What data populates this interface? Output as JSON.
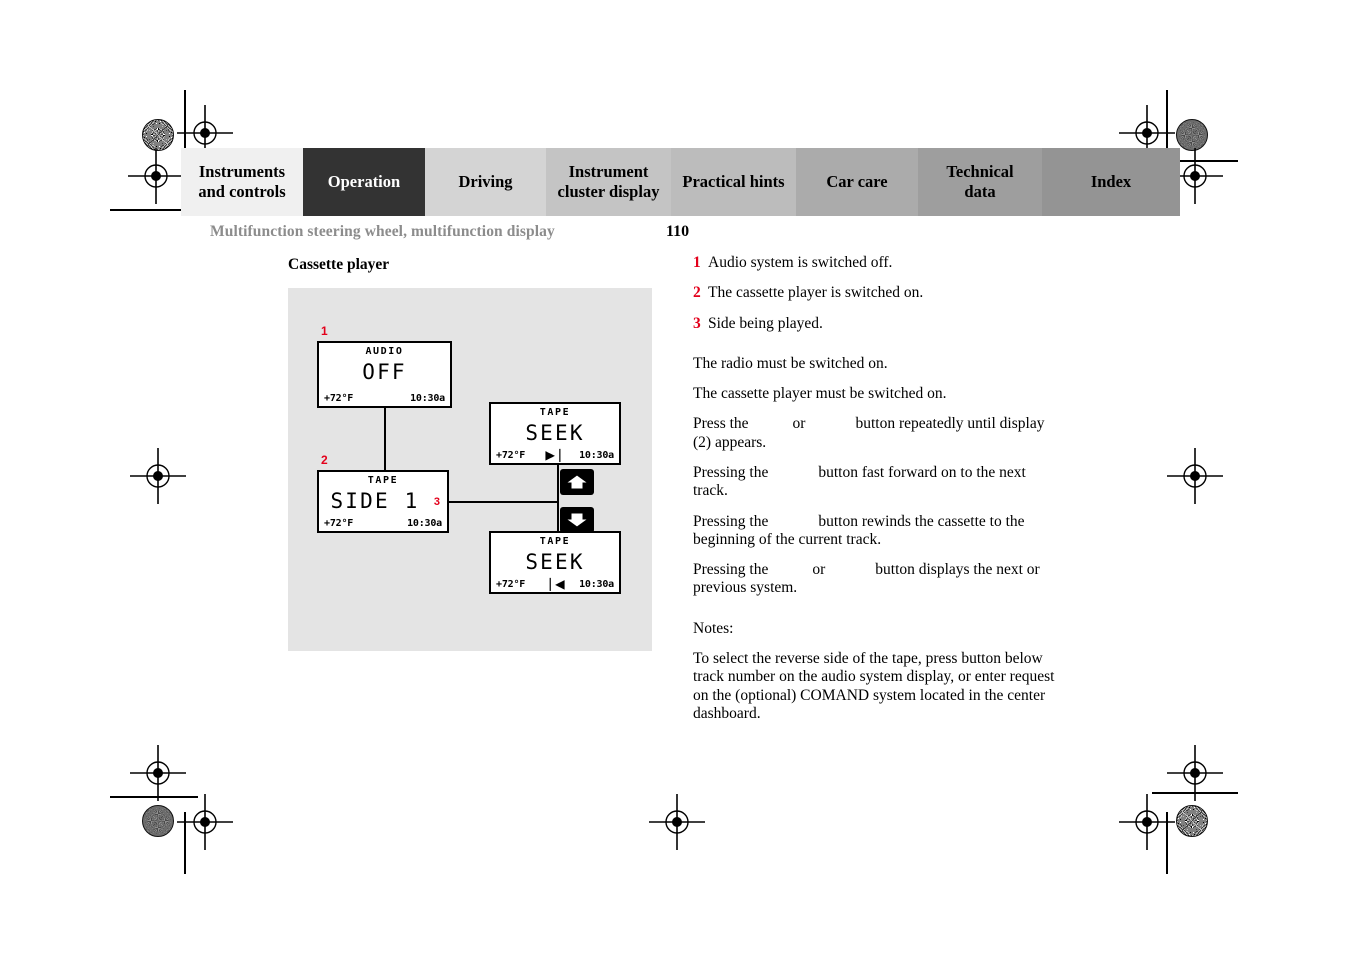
{
  "tabs": [
    {
      "label": "Instruments\nand controls",
      "bg": "#f0f0f0",
      "active": false
    },
    {
      "label": "Operation",
      "bg": "#333333",
      "active": true
    },
    {
      "label": "Driving",
      "bg": "#d4d4d4",
      "active": false
    },
    {
      "label": "Instrument\ncluster display",
      "bg": "#c4c4c4",
      "active": false
    },
    {
      "label": "Practical hints",
      "bg": "#bcbcbc",
      "active": false
    },
    {
      "label": "Car care",
      "bg": "#ababab",
      "active": false
    },
    {
      "label": "Technical\ndata",
      "bg": "#9e9e9e",
      "active": false
    },
    {
      "label": "Index",
      "bg": "#949494",
      "active": false
    }
  ],
  "header": {
    "running_title": "Multifunction steering wheel, multifunction display",
    "page_number": "110"
  },
  "section": {
    "title": "Cassette player"
  },
  "figure": {
    "callouts": {
      "one": "1",
      "two": "2",
      "three": "3"
    },
    "displays": [
      {
        "name": "audio-off",
        "top": "AUDIO",
        "main": "OFF",
        "bottom_left": "+72°F",
        "bottom_right": "10:30a",
        "bottom_center": ""
      },
      {
        "name": "tape-side-1",
        "top": "TAPE",
        "main": "SIDE 1",
        "bottom_left": "+72°F",
        "bottom_right": "10:30a",
        "bottom_center": ""
      },
      {
        "name": "tape-seek-forward",
        "top": "TAPE",
        "main": "SEEK",
        "bottom_left": "+72°F",
        "bottom_right": "10:30a",
        "bottom_center": "▶❘"
      },
      {
        "name": "tape-seek-rewind",
        "top": "TAPE",
        "main": "SEEK",
        "bottom_left": "+72°F",
        "bottom_right": "10:30a",
        "bottom_center": "❘◀"
      }
    ],
    "buttons": [
      {
        "name": "scroll-up-button",
        "icon": "arrow-up-icon"
      },
      {
        "name": "scroll-down-button",
        "icon": "arrow-down-icon"
      }
    ]
  },
  "legend": [
    {
      "num": "1",
      "text": "Audio system is switched off."
    },
    {
      "num": "2",
      "text": "The cassette player is switched on."
    },
    {
      "num": "3",
      "text": "Side being played."
    }
  ],
  "body": {
    "p1": "The radio must be switched on.",
    "p2": "The cassette player must be switched on.",
    "p3_a": "Press the",
    "p3_b": "or",
    "p3_c": "button repeatedly until display (2) appears.",
    "p4_a": "Pressing the",
    "p4_b": "button fast forward on to the next track.",
    "p5_a": "Pressing the",
    "p5_b": "button rewinds the cassette to the beginning of the current track.",
    "p6_a": "Pressing the",
    "p6_b": "or",
    "p6_c": "button displays the next or previous system.",
    "notes_label": "Notes:",
    "notes_text": "To select the reverse side of the tape, press button below track number on the audio system display, or enter request on the (optional) COMAND system located in the center dashboard."
  },
  "colors": {
    "callout_red": "#e3001b",
    "figure_bg": "#e4e4e4",
    "runhead_gray": "#8c8c8c"
  }
}
